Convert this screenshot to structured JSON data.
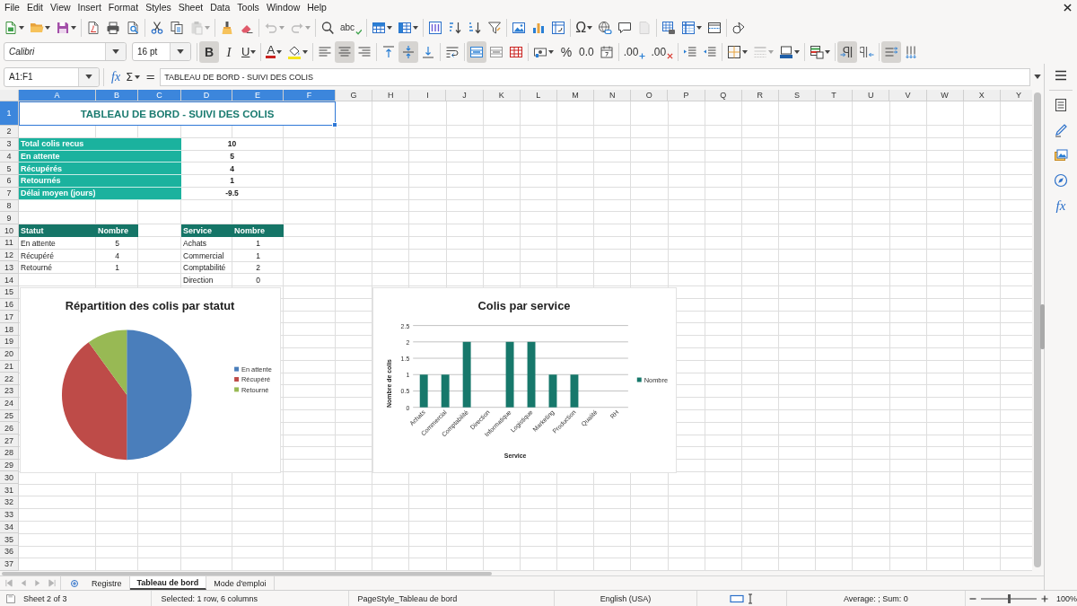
{
  "menu_bar": {
    "items": [
      "File",
      "Edit",
      "View",
      "Insert",
      "Format",
      "Styles",
      "Sheet",
      "Data",
      "Tools",
      "Window",
      "Help"
    ]
  },
  "standard_toolbar": {
    "groups": [
      {
        "buttons": [
          {
            "kind": "new",
            "dropdown": true,
            "disabled": false
          },
          {
            "kind": "open",
            "dropdown": true,
            "disabled": false
          },
          {
            "kind": "save",
            "dropdown": true,
            "disabled": false
          }
        ]
      },
      {
        "buttons": [
          {
            "kind": "export_pdf",
            "dropdown": false,
            "disabled": false
          },
          {
            "kind": "print",
            "dropdown": false,
            "disabled": false
          },
          {
            "kind": "print_preview",
            "dropdown": false,
            "disabled": false
          }
        ]
      },
      {
        "buttons": [
          {
            "kind": "cut",
            "dropdown": false,
            "disabled": false
          },
          {
            "kind": "copy",
            "dropdown": false,
            "disabled": false
          },
          {
            "kind": "paste",
            "dropdown": true,
            "disabled": true
          }
        ]
      },
      {
        "buttons": [
          {
            "kind": "clone",
            "dropdown": false,
            "disabled": false
          },
          {
            "kind": "clear_formatting",
            "dropdown": false,
            "disabled": false
          }
        ]
      },
      {
        "buttons": [
          {
            "kind": "undo",
            "dropdown": true,
            "disabled": true
          },
          {
            "kind": "redo",
            "dropdown": true,
            "disabled": true
          }
        ]
      },
      {
        "buttons": [
          {
            "kind": "find",
            "dropdown": false,
            "disabled": false
          },
          {
            "kind": "spelling",
            "label": "abc",
            "dropdown": false,
            "disabled": false
          }
        ]
      },
      {
        "buttons": [
          {
            "kind": "rows",
            "dropdown": true,
            "disabled": false
          },
          {
            "kind": "columns",
            "dropdown": true,
            "disabled": false
          }
        ]
      },
      {
        "buttons": [
          {
            "kind": "sort",
            "dropdown": false,
            "disabled": false
          },
          {
            "kind": "sort_ascending",
            "dropdown": false,
            "disabled": false
          },
          {
            "kind": "sort_descending",
            "dropdown": false,
            "disabled": false
          },
          {
            "kind": "autofilter",
            "dropdown": false,
            "disabled": false
          }
        ]
      },
      {
        "buttons": [
          {
            "kind": "image",
            "dropdown": false,
            "disabled": false
          },
          {
            "kind": "chart",
            "dropdown": false,
            "disabled": false
          },
          {
            "kind": "pivot_table",
            "dropdown": false,
            "disabled": false
          }
        ]
      },
      {
        "buttons": [
          {
            "kind": "special_character",
            "label": "Ω",
            "dropdown": true,
            "disabled": false
          },
          {
            "kind": "hyperlink",
            "dropdown": false,
            "disabled": false
          },
          {
            "kind": "comment",
            "dropdown": false,
            "disabled": false
          },
          {
            "kind": "header_footer",
            "dropdown": false,
            "disabled": true
          }
        ]
      },
      {
        "buttons": [
          {
            "kind": "print_area",
            "dropdown": false,
            "disabled": false
          },
          {
            "kind": "freeze",
            "dropdown": true,
            "disabled": false
          },
          {
            "kind": "split",
            "dropdown": false,
            "disabled": false
          }
        ]
      },
      {
        "buttons": [
          {
            "kind": "draw_functions",
            "dropdown": false,
            "disabled": false
          }
        ]
      }
    ]
  },
  "formatting_toolbar": {
    "font_name": "Calibri",
    "font_size": "16 pt",
    "groups": [
      {
        "buttons": [
          {
            "kind": "bold",
            "label": "B",
            "dropdown": false,
            "on": true,
            "disabled": false
          },
          {
            "kind": "italic",
            "label": "I",
            "dropdown": false,
            "on": false,
            "disabled": false
          },
          {
            "kind": "underline",
            "label": "U",
            "dropdown": true,
            "on": false,
            "disabled": false
          }
        ]
      },
      {
        "buttons": [
          {
            "kind": "font_color",
            "label": "A",
            "dropdown": true,
            "on": false,
            "disabled": false
          },
          {
            "kind": "highlight",
            "dropdown": true,
            "on": false,
            "disabled": false
          }
        ]
      },
      {
        "buttons": [
          {
            "kind": "align_left",
            "dropdown": false,
            "on": false,
            "disabled": false
          },
          {
            "kind": "align_center",
            "dropdown": false,
            "on": true,
            "disabled": false
          },
          {
            "kind": "align_right",
            "dropdown": false,
            "on": false,
            "disabled": false
          }
        ]
      },
      {
        "buttons": [
          {
            "kind": "align_top",
            "dropdown": false,
            "on": false,
            "disabled": false
          },
          {
            "kind": "align_middle",
            "dropdown": false,
            "on": true,
            "disabled": false
          },
          {
            "kind": "align_bottom",
            "dropdown": false,
            "on": false,
            "disabled": false
          }
        ]
      },
      {
        "buttons": [
          {
            "kind": "wrap",
            "dropdown": false,
            "on": false,
            "disabled": false
          }
        ]
      },
      {
        "buttons": [
          {
            "kind": "merge_center",
            "dropdown": false,
            "on": true,
            "disabled": false
          },
          {
            "kind": "merge",
            "dropdown": false,
            "on": false,
            "disabled": false
          },
          {
            "kind": "unmerge",
            "dropdown": false,
            "on": false,
            "disabled": false
          }
        ]
      },
      {
        "buttons": [
          {
            "kind": "number_format",
            "dropdown": true,
            "on": false,
            "disabled": false
          },
          {
            "kind": "percent",
            "label": "%",
            "dropdown": false,
            "on": false,
            "disabled": false
          },
          {
            "kind": "standard",
            "label": "0.0",
            "dropdown": false,
            "on": false,
            "disabled": false
          },
          {
            "kind": "date",
            "dropdown": false,
            "on": false,
            "disabled": false
          }
        ]
      },
      {
        "buttons": [
          {
            "kind": "add_decimal",
            "label": ".00",
            "dropdown": false,
            "on": false,
            "disabled": false
          },
          {
            "kind": "delete_decimal",
            "label": ".00",
            "dropdown": false,
            "on": false,
            "disabled": false
          }
        ]
      },
      {
        "buttons": [
          {
            "kind": "indent",
            "dropdown": false,
            "on": false,
            "disabled": false
          },
          {
            "kind": "outdent",
            "dropdown": false,
            "on": false,
            "disabled": false
          }
        ]
      },
      {
        "buttons": [
          {
            "kind": "borders",
            "dropdown": true,
            "on": false,
            "disabled": false
          },
          {
            "kind": "border_style",
            "dropdown": true,
            "on": false,
            "disabled": true
          },
          {
            "kind": "border_color",
            "dropdown": true,
            "on": false,
            "disabled": false
          }
        ]
      },
      {
        "buttons": [
          {
            "kind": "conditional",
            "dropdown": true,
            "on": false,
            "disabled": false
          }
        ]
      },
      {
        "buttons": [
          {
            "kind": "left_to_right",
            "dropdown": false,
            "on": true,
            "disabled": false
          },
          {
            "kind": "right_to_left",
            "dropdown": false,
            "on": false,
            "disabled": false
          }
        ]
      },
      {
        "buttons": [
          {
            "kind": "text_horizontal",
            "dropdown": false,
            "on": true,
            "disabled": false
          },
          {
            "kind": "text_vertical",
            "dropdown": false,
            "on": false,
            "disabled": false
          }
        ]
      }
    ]
  },
  "formula_bar": {
    "name_box": "A1:F1",
    "function_wizard": "fx",
    "sum": "Σ",
    "equals": "=",
    "content": "TABLEAU DE BORD - SUIVI DES COLIS"
  },
  "sheet": {
    "columns": [
      {
        "label": "A",
        "selected": true
      },
      {
        "label": "B",
        "selected": true
      },
      {
        "label": "C",
        "selected": true
      },
      {
        "label": "D",
        "selected": true
      },
      {
        "label": "E",
        "selected": true
      },
      {
        "label": "F",
        "selected": true
      },
      {
        "label": "G",
        "selected": false
      },
      {
        "label": "H",
        "selected": false
      },
      {
        "label": "I",
        "selected": false
      },
      {
        "label": "J",
        "selected": false
      },
      {
        "label": "K",
        "selected": false
      },
      {
        "label": "L",
        "selected": false
      },
      {
        "label": "M",
        "selected": false
      },
      {
        "label": "N",
        "selected": false
      },
      {
        "label": "O",
        "selected": false
      },
      {
        "label": "P",
        "selected": false
      },
      {
        "label": "Q",
        "selected": false
      },
      {
        "label": "R",
        "selected": false
      },
      {
        "label": "S",
        "selected": false
      },
      {
        "label": "T",
        "selected": false
      },
      {
        "label": "U",
        "selected": false
      },
      {
        "label": "V",
        "selected": false
      },
      {
        "label": "W",
        "selected": false
      },
      {
        "label": "X",
        "selected": false
      },
      {
        "label": "Y",
        "selected": false
      }
    ],
    "rows": [
      {
        "label": "1",
        "selected": true
      },
      {
        "label": "2",
        "selected": false
      },
      {
        "label": "3",
        "selected": false
      },
      {
        "label": "4",
        "selected": false
      },
      {
        "label": "5",
        "selected": false
      },
      {
        "label": "6",
        "selected": false
      },
      {
        "label": "7",
        "selected": false
      },
      {
        "label": "8",
        "selected": false
      },
      {
        "label": "9",
        "selected": false
      },
      {
        "label": "10",
        "selected": false
      },
      {
        "label": "11",
        "selected": false
      },
      {
        "label": "12",
        "selected": false
      },
      {
        "label": "13",
        "selected": false
      },
      {
        "label": "14",
        "selected": false
      },
      {
        "label": "15",
        "selected": false
      },
      {
        "label": "16",
        "selected": false
      },
      {
        "label": "17",
        "selected": false
      },
      {
        "label": "18",
        "selected": false
      },
      {
        "label": "19",
        "selected": false
      },
      {
        "label": "20",
        "selected": false
      },
      {
        "label": "21",
        "selected": false
      },
      {
        "label": "22",
        "selected": false
      },
      {
        "label": "23",
        "selected": false
      },
      {
        "label": "24",
        "selected": false
      },
      {
        "label": "25",
        "selected": false
      },
      {
        "label": "26",
        "selected": false
      },
      {
        "label": "27",
        "selected": false
      },
      {
        "label": "28",
        "selected": false
      },
      {
        "label": "29",
        "selected": false
      },
      {
        "label": "30",
        "selected": false
      },
      {
        "label": "31",
        "selected": false
      },
      {
        "label": "32",
        "selected": false
      },
      {
        "label": "33",
        "selected": false
      },
      {
        "label": "34",
        "selected": false
      },
      {
        "label": "35",
        "selected": false
      },
      {
        "label": "36",
        "selected": false
      },
      {
        "label": "37",
        "selected": false
      }
    ],
    "title": {
      "text": "TABLEAU DE BORD - SUIVI DES COLIS",
      "selected": true
    },
    "summary": [
      {
        "label": "Total colis recus",
        "value": "10"
      },
      {
        "label": "En attente",
        "value": "5"
      },
      {
        "label": "Récupérés",
        "value": "4"
      },
      {
        "label": "Retournés",
        "value": "1"
      },
      {
        "label": "Délai moyen (jours)",
        "value": "-9.5"
      }
    ],
    "status_table": {
      "columns": [
        "Statut",
        "Nombre"
      ],
      "rows": [
        [
          "En attente",
          "5"
        ],
        [
          "Récupéré",
          "4"
        ],
        [
          "Retourné",
          "1"
        ]
      ]
    },
    "service_table": {
      "columns": [
        "Service",
        "Nombre"
      ],
      "rows": [
        [
          "Achats",
          "1"
        ],
        [
          "Commercial",
          "1"
        ],
        [
          "Comptabilité",
          "2"
        ],
        [
          "Direction",
          "0"
        ]
      ]
    }
  },
  "charts": [
    {
      "chart_data": {
        "type": "pie",
        "title": "Répartition des colis par statut",
        "categories": [
          "En attente",
          "Récupéré",
          "Retourné"
        ],
        "series": [
          {
            "values": [
              50,
              40,
              10
            ]
          }
        ],
        "legend": "right"
      },
      "slices": [
        {
          "color": "#4a7ebb"
        },
        {
          "color": "#be4b48"
        },
        {
          "color": "#98b954"
        }
      ]
    },
    {
      "chart_data": {
        "type": "bar",
        "title": "Colis par service",
        "xlabel": "Service",
        "ylabel": "Nombre de colis",
        "categories": [
          "Achats",
          "Commercial",
          "Comptabilité",
          "Direction",
          "Informatique",
          "Logistique",
          "Marketing",
          "Production",
          "Qualité",
          "RH"
        ],
        "series": [
          {
            "name": "Nombre",
            "color": "#17786b",
            "values": [
              1,
              1,
              2,
              0,
              2,
              2,
              1,
              1,
              0,
              0
            ]
          }
        ],
        "ylim": [
          0,
          2.5
        ],
        "yticks": [
          0,
          0.5,
          1,
          1.5,
          2,
          2.5
        ],
        "grid": true,
        "legend": "right"
      }
    }
  ],
  "sidebar": {
    "functions_label": "fx"
  },
  "sheet_tabs": [
    {
      "label": "Registre",
      "selected": false
    },
    {
      "label": "Tableau de bord",
      "selected": true
    },
    {
      "label": "Mode d'emploi",
      "selected": false
    }
  ],
  "status_bar": {
    "sheet_position": "Sheet 2 of 3",
    "selection": "Selected: 1 row, 6 columns",
    "page_style": "PageStyle_Tableau de bord",
    "language": "English (USA)",
    "summary": "Average: ; Sum: 0",
    "zoom": {
      "level": 0.5,
      "reading": "100%"
    }
  }
}
